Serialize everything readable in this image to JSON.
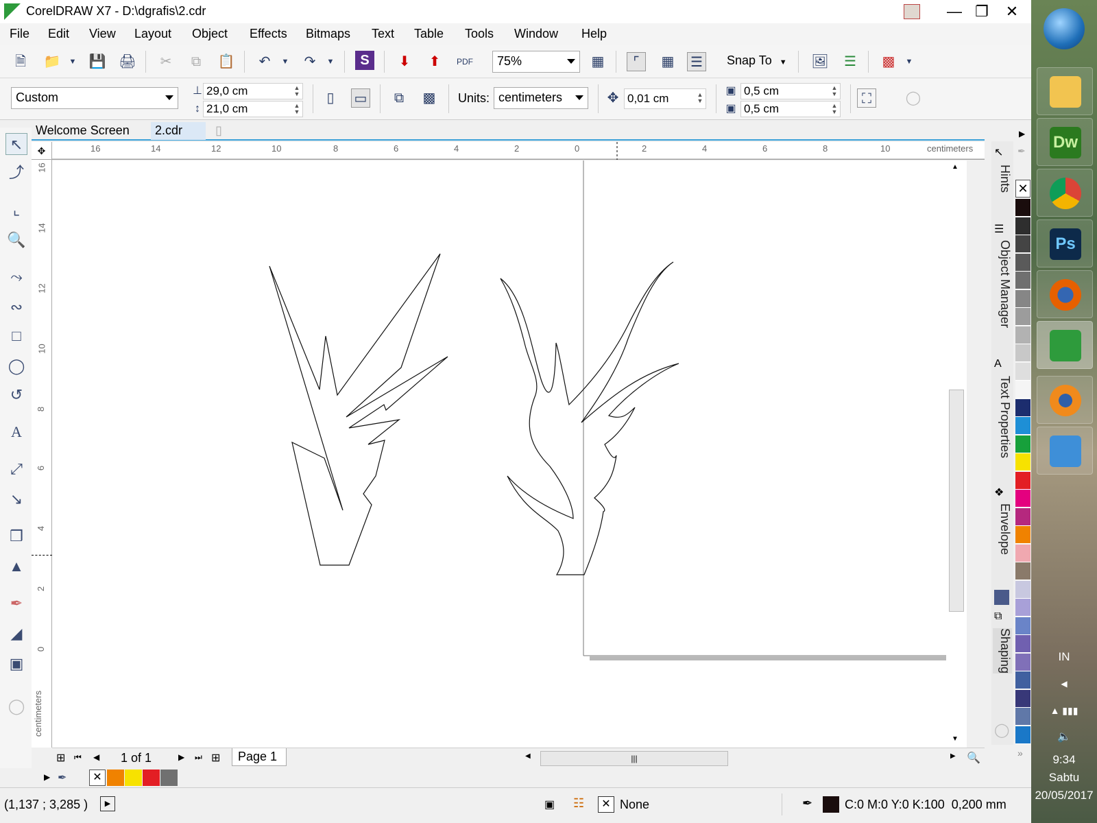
{
  "window": {
    "title": "CorelDRAW X7 - D:\\dgrafis\\2.cdr"
  },
  "menu": [
    "File",
    "Edit",
    "View",
    "Layout",
    "Object",
    "Effects",
    "Bitmaps",
    "Text",
    "Table",
    "Tools",
    "Window",
    "Help"
  ],
  "toolbar": {
    "zoom": "75%",
    "snap_to": "Snap To"
  },
  "property_bar": {
    "page_preset": "Custom",
    "page_width": "29,0 cm",
    "page_height": "21,0 cm",
    "units_label": "Units:",
    "units_value": "centimeters",
    "nudge": "0,01 cm",
    "duplicate_x": "0,5 cm",
    "duplicate_y": "0,5 cm"
  },
  "tabs": [
    "Welcome Screen",
    "2.cdr"
  ],
  "rulers": {
    "unit": "centimeters",
    "h_labels": [
      "16",
      "14",
      "12",
      "10",
      "8",
      "6",
      "4",
      "2",
      "0",
      "2",
      "4",
      "6",
      "8",
      "10"
    ],
    "v_labels": [
      "16",
      "14",
      "12",
      "10",
      "8",
      "6",
      "4",
      "2",
      "0"
    ]
  },
  "dockers": [
    "Hints",
    "Object Manager",
    "Text Properties",
    "Envelope",
    "Shaping"
  ],
  "palette_colors": [
    "#1a0d0d",
    "#2e2e2e",
    "#444444",
    "#5a5a5a",
    "#707070",
    "#868686",
    "#9c9c9c",
    "#b2b2b2",
    "#c8c8c8",
    "#dedede",
    "#f5f5f5",
    "#1c2d6e",
    "#1e8fd6",
    "#17a03b",
    "#f7e200",
    "#e31e24",
    "#e4007f",
    "#b5287e",
    "#f08200",
    "#f0a8b0",
    "#8a7a6a",
    "#c8c8e0",
    "#a8a0d8",
    "#6a84c8",
    "#7060b0",
    "#8070b8",
    "#4060a0",
    "#383878",
    "#6078a8",
    "#1a78c8"
  ],
  "page_nav": {
    "counter": "1 of 1",
    "page_tab": "Page 1"
  },
  "document_palette": [
    "#f08200",
    "#f7e200",
    "#e31e24",
    "#707070"
  ],
  "status": {
    "coords": "(1,137 ; 3,285 )",
    "fill": "None",
    "outline": "C:0 M:0 Y:0 K:100  0,200 mm"
  },
  "taskbar": {
    "apps": [
      "Windows Explorer",
      "Dreamweaver",
      "Chrome",
      "Photoshop",
      "Firefox",
      "CorelDRAW",
      "Blender",
      "Control Panel"
    ],
    "dw_label": "Dw",
    "ps_label": "Ps",
    "lang": "IN",
    "time": "9:34",
    "day": "Sabtu",
    "date": "20/05/2017"
  }
}
